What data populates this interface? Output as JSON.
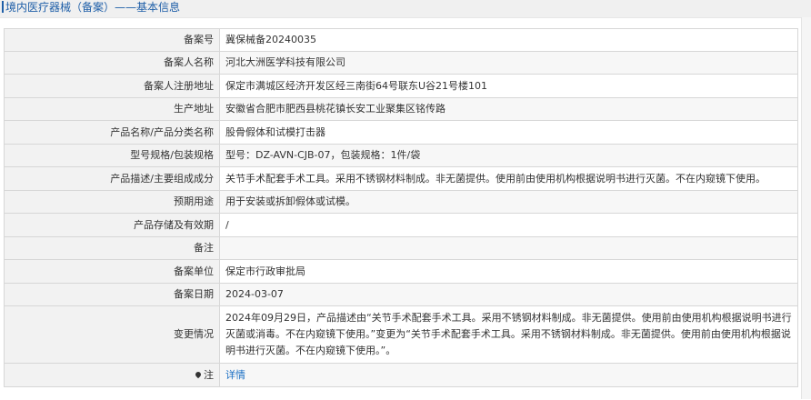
{
  "header": {
    "title": "境内医疗器械（备案）——基本信息"
  },
  "rows": [
    {
      "key": "备案号",
      "value": "冀保械备20240035"
    },
    {
      "key": "备案人名称",
      "value": "河北大洲医学科技有限公司"
    },
    {
      "key": "备案人注册地址",
      "value": "保定市满城区经济开发区经三南街64号联东U谷21号楼101"
    },
    {
      "key": "生产地址",
      "value": "安徽省合肥市肥西县桃花镇长安工业聚集区铭传路"
    },
    {
      "key": "产品名称/产品分类名称",
      "value": "股骨假体和试模打击器"
    },
    {
      "key": "型号规格/包装规格",
      "value": "型号：DZ-AVN-CJB-07，包装规格：1件/袋"
    },
    {
      "key": "产品描述/主要组成成分",
      "value": "关节手术配套手术工具。采用不锈钢材料制成。非无菌提供。使用前由使用机构根据说明书进行灭菌。不在内窥镜下使用。"
    },
    {
      "key": "预期用途",
      "value": "用于安装或拆卸假体或试模。"
    },
    {
      "key": "产品存储及有效期",
      "value": "/"
    },
    {
      "key": "备注",
      "value": ""
    },
    {
      "key": "备案单位",
      "value": "保定市行政审批局"
    },
    {
      "key": "备案日期",
      "value": "2024-03-07"
    },
    {
      "key": "变更情况",
      "value": "2024年09月29日，产品描述由“关节手术配套手术工具。采用不锈钢材料制成。非无菌提供。使用前由使用机构根据说明书进行灭菌或消毒。不在内窥镜下使用。”变更为“关节手术配套手术工具。采用不锈钢材料制成。非无菌提供。使用前由使用机构根据说明书进行灭菌。不在内窥镜下使用。”。"
    }
  ],
  "note": {
    "key": "注",
    "link": "详情"
  }
}
